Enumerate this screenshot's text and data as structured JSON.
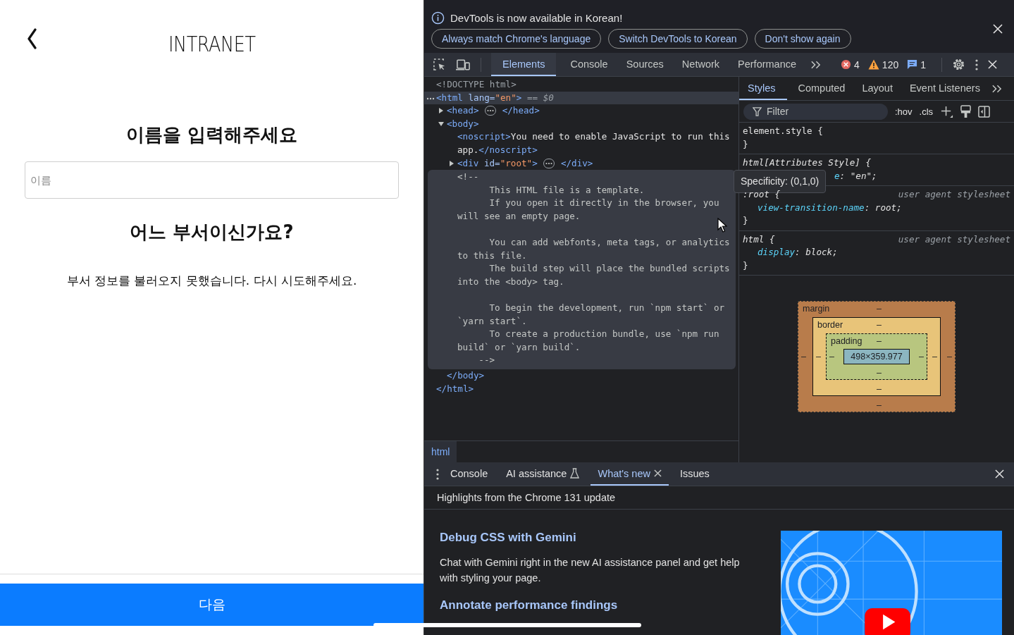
{
  "app": {
    "title": "INTRANET",
    "name_heading": "이름을 입력해주세요",
    "name_field": {
      "placeholder": "이름"
    },
    "dept_heading": "어느 부서이신가요?",
    "error_message": "부서 정보를 불러오지 못했습니다. 다시 시도해주세요.",
    "next_button": "다음"
  },
  "devtools": {
    "infobar": {
      "message": "DevTools is now available in Korean!",
      "buttons": [
        "Always match Chrome's language",
        "Switch DevTools to Korean",
        "Don't show again"
      ]
    },
    "tabs": [
      {
        "label": "Elements",
        "selected": true
      },
      {
        "label": "Console",
        "selected": false
      },
      {
        "label": "Sources",
        "selected": false
      },
      {
        "label": "Network",
        "selected": false
      },
      {
        "label": "Performance",
        "selected": false
      }
    ],
    "counts": {
      "errors": "4",
      "warnings": "120",
      "messages": "1"
    },
    "dom_tree": [
      {
        "tokens": [
          {
            "kind": "doctype",
            "text": "<!DOCTYPE html>"
          }
        ]
      },
      {
        "selected": true,
        "tokens": [
          {
            "kind": "tag",
            "text": "<html "
          },
          {
            "kind": "attr",
            "text": "lang="
          },
          {
            "kind": "value",
            "text": "\"en\""
          },
          {
            "kind": "tag",
            "text": ">"
          },
          {
            "kind": "hint",
            "text": " == $0"
          }
        ],
        "close": [
          {
            "kind": "tag",
            "text": "</html>"
          }
        ],
        "children": [
          {
            "selected": false,
            "expanded": false,
            "tokens": [
              {
                "kind": "tag",
                "text": "<head>"
              }
            ],
            "close": [
              {
                "kind": "tag",
                "text": "</head>"
              }
            ]
          },
          {
            "selected": false,
            "expanded": true,
            "tokens": [
              {
                "kind": "tag",
                "text": "<body>"
              }
            ],
            "close": [
              {
                "kind": "tag",
                "text": "</body>"
              }
            ],
            "children": [
              {
                "selected": false,
                "tokens": [
                  {
                    "kind": "tag",
                    "text": "<noscript>"
                  },
                  {
                    "kind": "text",
                    "text": "You need to enable JavaScript to run this app."
                  },
                  {
                    "kind": "tag",
                    "text": "</noscript>"
                  }
                ]
              },
              {
                "selected": false,
                "expanded": false,
                "tokens": [
                  {
                    "kind": "tag",
                    "text": "<div "
                  },
                  {
                    "kind": "attr",
                    "text": "id="
                  },
                  {
                    "kind": "value",
                    "text": "\"root\""
                  },
                  {
                    "kind": "tag",
                    "text": ">"
                  }
                ],
                "close": [
                  {
                    "kind": "tag",
                    "text": "</div>"
                  }
                ]
              },
              {
                "kind": "comment",
                "text": "<!--\n      This HTML file is a template.\n      If you open it directly in the browser, you will see an empty page.\n\n      You can add webfonts, meta tags, or analytics to this file.\n      The build step will place the bundled scripts into the <body> tag.\n\n      To begin the development, run `npm start` or `yarn start`.\n      To create a production bundle, use `npm run build` or `yarn build`.\n    -->"
              }
            ]
          }
        ]
      }
    ],
    "breadcrumb": "html",
    "styles_tabs": [
      {
        "label": "Styles",
        "selected": true
      },
      {
        "label": "Computed",
        "selected": false
      },
      {
        "label": "Layout",
        "selected": false
      },
      {
        "label": "Event Listeners",
        "selected": false
      }
    ],
    "filter": {
      "placeholder": "Filter"
    },
    "style_actions": [
      ":hov",
      ".cls"
    ],
    "rules": [
      {
        "selector": "element.style {",
        "italic": false,
        "close": "}"
      },
      {
        "selector": "html[Attributes Style] {",
        "italic": true,
        "declarations": [
          {
            "property": "e",
            "value": ": \"en\";"
          }
        ]
      },
      {
        "selector": ":root {",
        "italic": true,
        "source": "user agent stylesheet",
        "close": "}",
        "declarations": [
          {
            "property": "view-transition-name",
            "value": ": root;"
          }
        ]
      },
      {
        "selector": "html {",
        "italic": true,
        "source": "user agent stylesheet",
        "close": "}",
        "declarations": [
          {
            "property": "display",
            "value": ": block;"
          }
        ]
      }
    ],
    "tooltip": "Specificity: (0,1,0)",
    "box_model": {
      "margin": {
        "label": "margin",
        "top": "–",
        "right": "–",
        "bottom": "–",
        "left": "–"
      },
      "border": {
        "label": "border",
        "top": "–",
        "right": "–",
        "bottom": "–",
        "left": "–"
      },
      "padding": {
        "label": "padding",
        "top": "–",
        "right": "–",
        "bottom": "–",
        "left": "–"
      },
      "content": "498×359.977"
    },
    "drawer_tabs": [
      {
        "label": "Console",
        "selected": false
      },
      {
        "label": "AI assistance",
        "selected": false,
        "kind": "experimental"
      },
      {
        "label": "What's new",
        "selected": true,
        "closable": true
      },
      {
        "label": "Issues",
        "selected": false
      }
    ],
    "whats_new": {
      "header": "Highlights from the Chrome 131 update",
      "articles": [
        {
          "title": "Debug CSS with Gemini",
          "body": "Chat with Gemini right in the new AI assistance panel and get help with styling your page."
        },
        {
          "title": "Annotate performance findings"
        }
      ]
    }
  }
}
